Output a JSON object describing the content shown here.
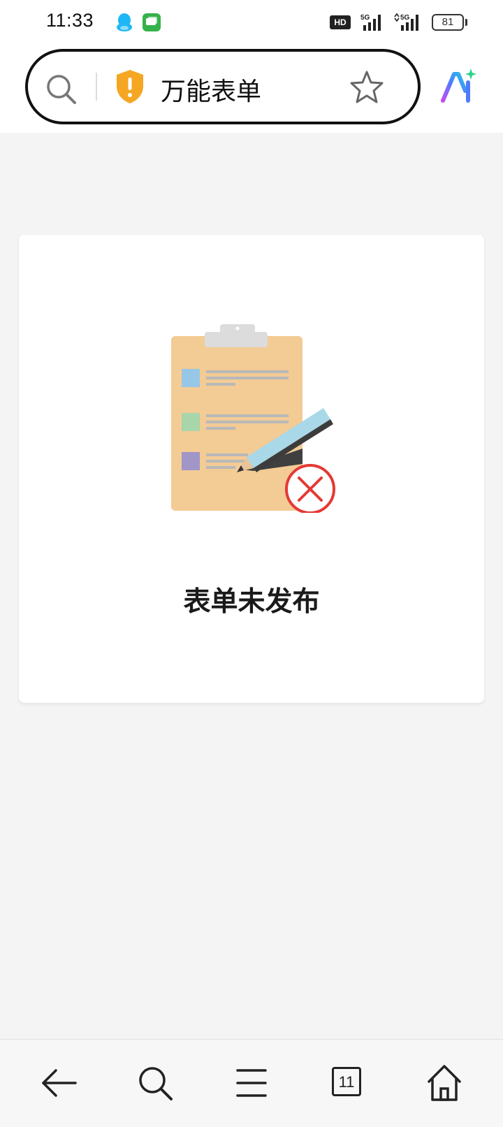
{
  "status_bar": {
    "time": "11:33",
    "notification_icons": [
      "qq-icon",
      "messages-icon"
    ],
    "hd_label": "HD",
    "network_1": "5G",
    "network_2": "5G",
    "battery_level": "81"
  },
  "address_bar": {
    "title": "万能表单",
    "icons": [
      "search-icon",
      "security-warning-icon",
      "star-icon"
    ]
  },
  "ai_button": {
    "icon": "ai-assistant-icon"
  },
  "card": {
    "illustration": "clipboard-error-icon",
    "message": "表单未发布"
  },
  "bottom_nav": {
    "items": [
      {
        "icon": "back-arrow-icon"
      },
      {
        "icon": "search-icon"
      },
      {
        "icon": "menu-icon"
      },
      {
        "icon": "tabs-icon",
        "count": "11"
      },
      {
        "icon": "home-icon"
      }
    ]
  },
  "colors": {
    "warning_shield": "#F5A623",
    "error_red": "#E53935",
    "clipboard": "#F3CB95",
    "page_background": "#F4F4F4"
  }
}
